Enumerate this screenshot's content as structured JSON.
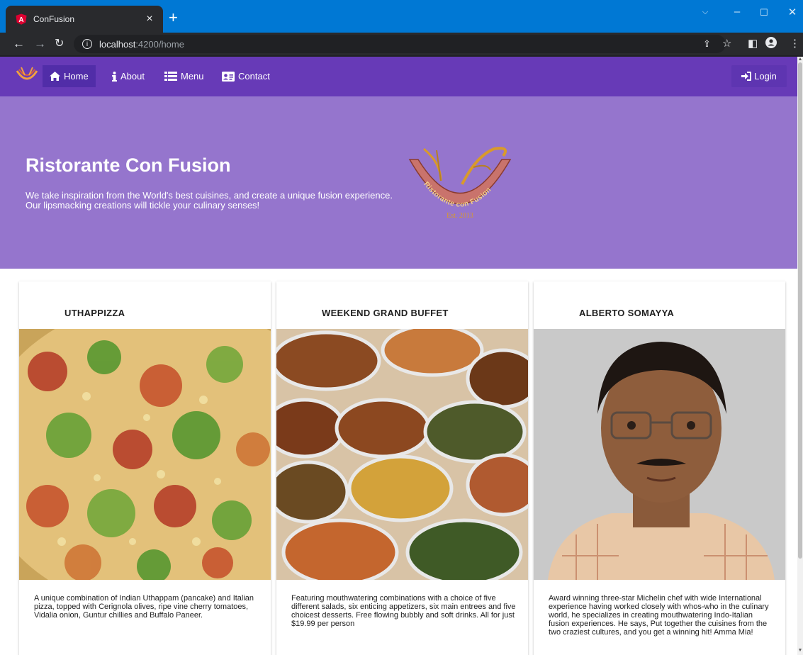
{
  "browser": {
    "tab_title": "ConFusion",
    "tab_favicon_letter": "A",
    "url_host": "localhost",
    "url_path": ":4200/home"
  },
  "navbar": {
    "items": [
      {
        "label": "Home",
        "icon": "home-icon",
        "active": true
      },
      {
        "label": "About",
        "icon": "info-icon",
        "active": false
      },
      {
        "label": "Menu",
        "icon": "list-icon",
        "active": false
      },
      {
        "label": "Contact",
        "icon": "address-card-icon",
        "active": false
      }
    ],
    "login_label": "Login"
  },
  "jumbotron": {
    "title": "Ristorante Con Fusion",
    "text": "We take inspiration from the World's best cuisines, and create a unique fusion experience. Our lipsmacking creations will tickle your culinary senses!",
    "logo_text": "Ristorante con Fusion",
    "logo_est": "Est. 2013"
  },
  "cards": [
    {
      "title": "UTHAPPIZZA",
      "description": "A unique combination of Indian Uthappam (pancake) and Italian pizza, topped with Cerignola olives, ripe vine cherry tomatoes, Vidalia onion, Guntur chillies and Buffalo Paneer."
    },
    {
      "title": "WEEKEND GRAND BUFFET",
      "description": "Featuring mouthwatering combinations with a choice of five different salads, six enticing appetizers, six main entrees and five choicest desserts. Free flowing bubbly and soft drinks. All for just $19.99 per person"
    },
    {
      "title": "ALBERTO SOMAYYA",
      "description": "Award winning three-star Michelin chef with wide International experience having worked closely with whos-who in the culinary world, he specializes in creating mouthwatering Indo-Italian fusion experiences. He says, Put together the cuisines from the two craziest cultures, and you get a winning hit! Amma Mia!"
    }
  ],
  "colors": {
    "navbar": "#673ab7",
    "navbar_active": "#512da8",
    "jumbotron": "#9575cd",
    "browser_accent": "#0078d4"
  }
}
